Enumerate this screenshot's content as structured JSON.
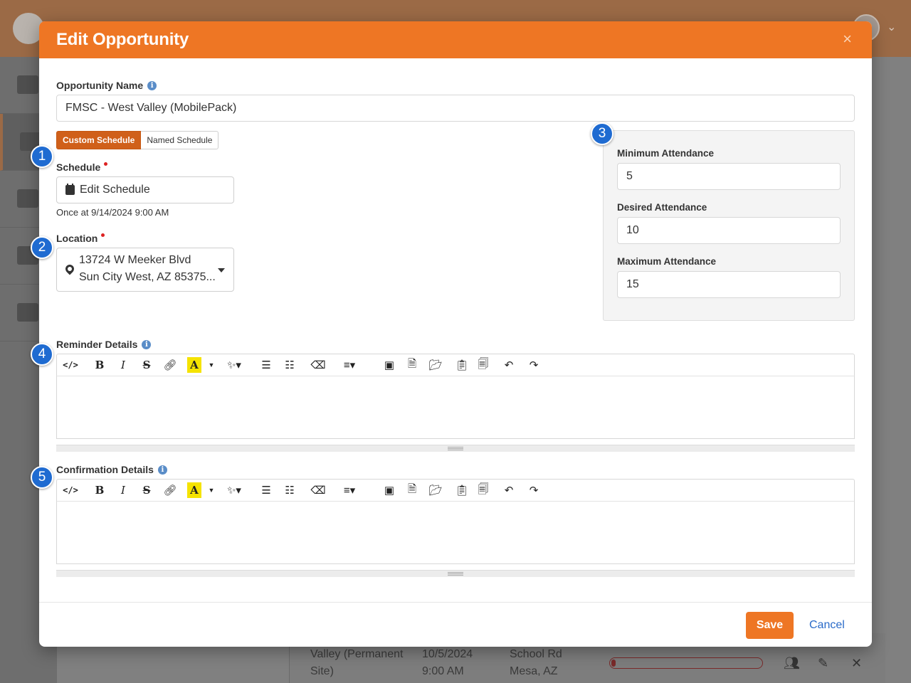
{
  "background": {
    "rows": [
      {
        "col1_line1": "Valley (Permanent",
        "col1_line2": "Site)",
        "date": "10/5/2024",
        "time": "9:00 AM",
        "loc_line1": "School Rd",
        "loc_line2": "Mesa, AZ"
      }
    ],
    "progress_fraction": 0.01
  },
  "modal": {
    "title": "Edit Opportunity",
    "close_glyph": "×",
    "opportunity_name": {
      "label": "Opportunity Name",
      "value": "FMSC - West Valley (MobilePack)"
    },
    "schedule_toggle": {
      "custom": "Custom Schedule",
      "named": "Named Schedule",
      "selected": "Custom Schedule"
    },
    "schedule": {
      "label": "Schedule",
      "button_label": "Edit Schedule",
      "summary": "Once at 9/14/2024 9:00 AM"
    },
    "location": {
      "label": "Location",
      "line1": "13724 W Meeker Blvd",
      "line2": "Sun City West, AZ 85375..."
    },
    "attendance": {
      "minimum": {
        "label": "Minimum Attendance",
        "value": "5"
      },
      "desired": {
        "label": "Desired Attendance",
        "value": "10"
      },
      "maximum": {
        "label": "Maximum Attendance",
        "value": "15"
      }
    },
    "reminder_details": {
      "label": "Reminder Details"
    },
    "confirmation_details": {
      "label": "Confirmation Details"
    },
    "badges": [
      "1",
      "2",
      "3",
      "4",
      "5"
    ],
    "footer": {
      "save": "Save",
      "cancel": "Cancel"
    }
  },
  "colors": {
    "accent": "#ee7624",
    "badge": "#1f6bd1",
    "link": "#2a6bc9",
    "toggle_active": "#d0601a"
  }
}
